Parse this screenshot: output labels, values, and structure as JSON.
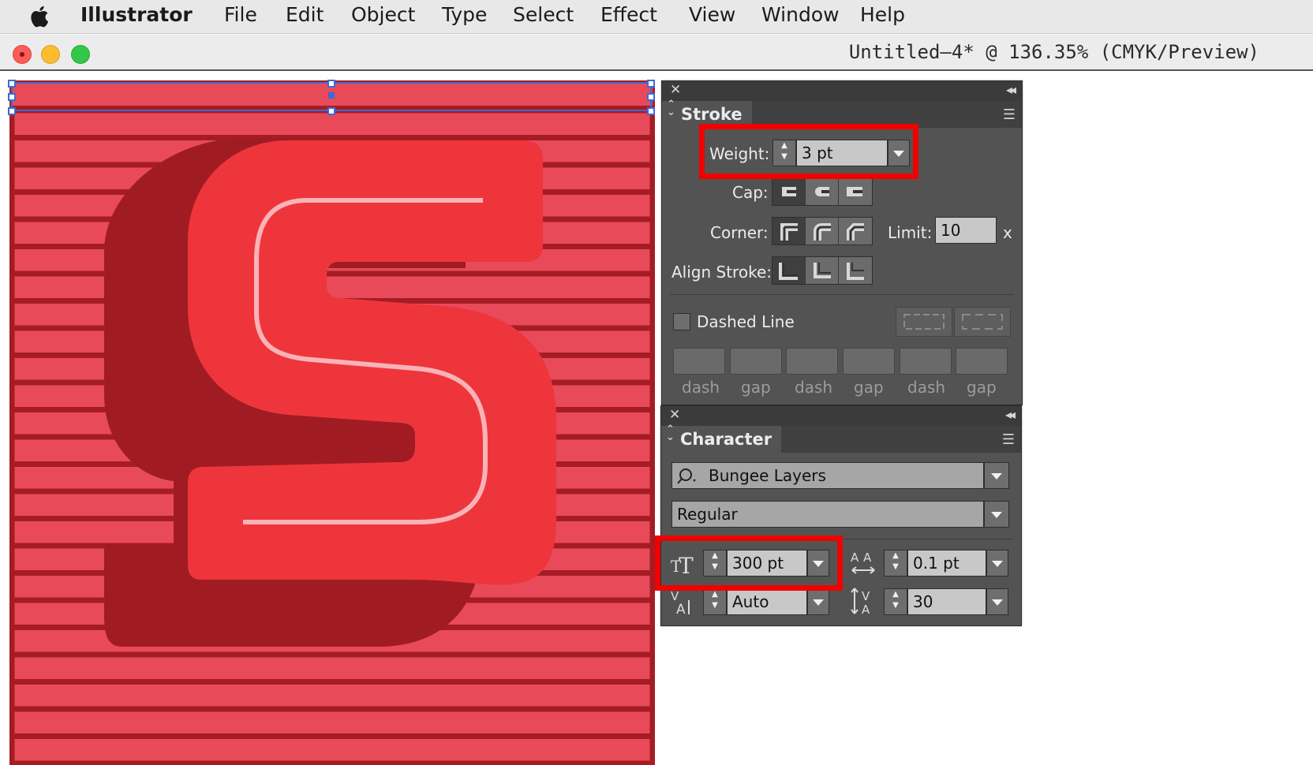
{
  "menubar": {
    "app_name": "Illustrator",
    "items": [
      "File",
      "Edit",
      "Object",
      "Type",
      "Select",
      "Effect",
      "View",
      "Window",
      "Help"
    ]
  },
  "window": {
    "title": "Untitled–4* @ 136.35% (CMYK/Preview)"
  },
  "colors": {
    "highlight": "#f00000",
    "artboard_red": "#e84a5a",
    "stripe_dark": "#a51c24",
    "letter_red": "#ef353c",
    "panel_bg": "#535353",
    "selection_blue": "#3b6bd6"
  },
  "stroke_panel": {
    "tab_label": "Stroke",
    "weight_label": "Weight:",
    "weight_value": "3 pt",
    "cap_label": "Cap:",
    "corner_label": "Corner:",
    "limit_label": "Limit:",
    "limit_value": "10",
    "limit_unit": "x",
    "align_label": "Align Stroke:",
    "dashed_label": "Dashed Line",
    "dashed_checked": false,
    "dash_fields": [
      "dash",
      "gap",
      "dash",
      "gap",
      "dash",
      "gap"
    ]
  },
  "character_panel": {
    "tab_label": "Character",
    "font_family": "Bungee Layers",
    "font_style": "Regular",
    "font_size": "300 pt",
    "leading": "0.1 pt",
    "kerning": "Auto",
    "tracking": "30"
  },
  "artwork": {
    "letter": "S"
  }
}
